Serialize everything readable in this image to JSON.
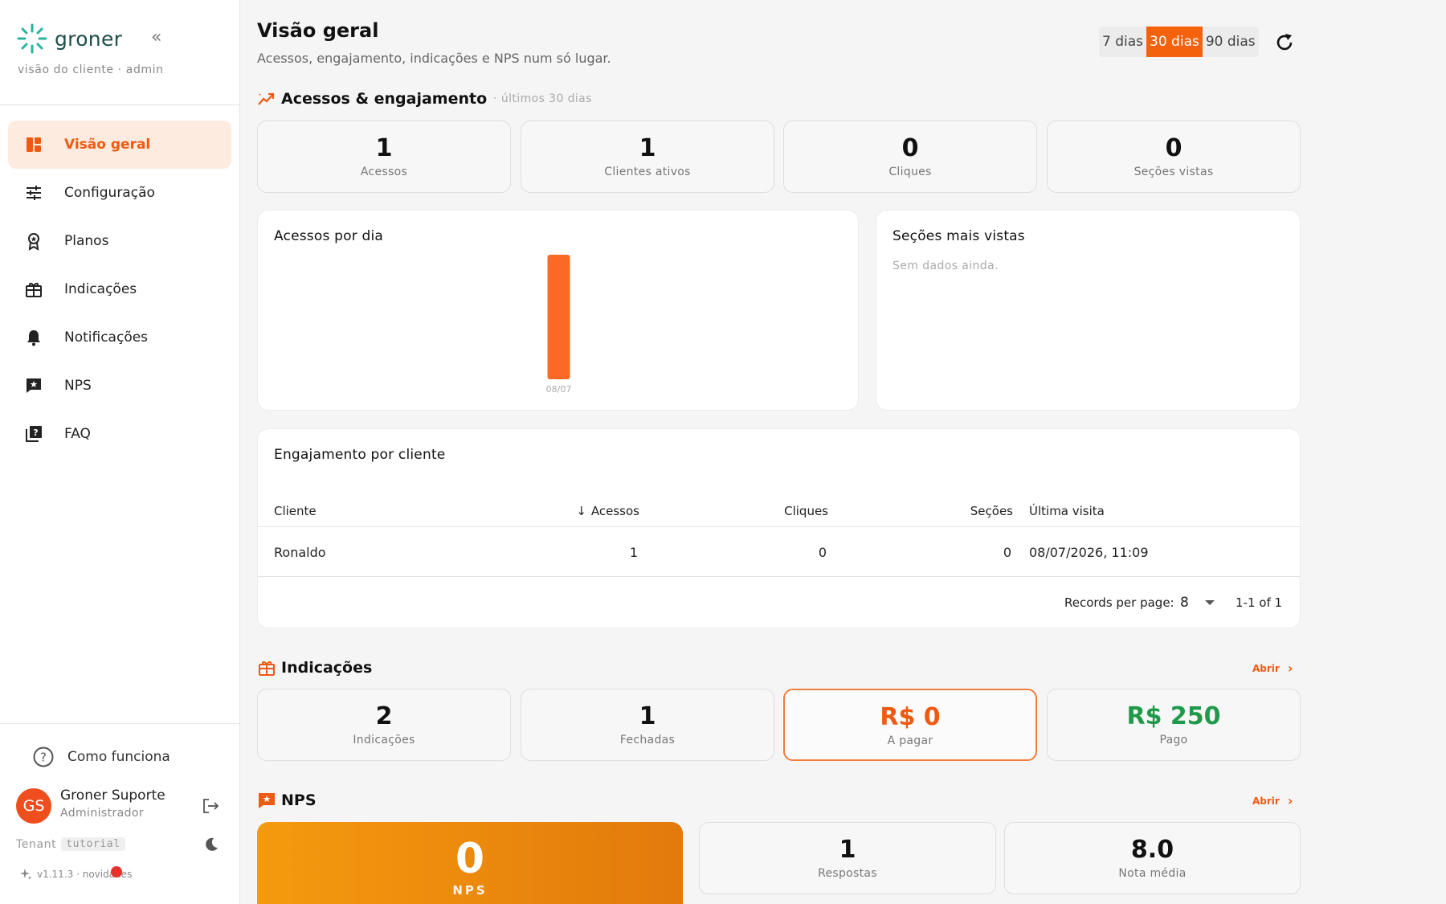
{
  "brand": {
    "name": "groner",
    "subtitle": "visão do cliente · admin",
    "collapse": "«"
  },
  "nav": [
    {
      "label": "Visão geral",
      "icon": "dashboard-icon",
      "active": true
    },
    {
      "label": "Configuração",
      "icon": "sliders-icon"
    },
    {
      "label": "Planos",
      "icon": "award-icon"
    },
    {
      "label": "Indicações",
      "icon": "gift-icon"
    },
    {
      "label": "Notificações",
      "icon": "bell-icon"
    },
    {
      "label": "NPS",
      "icon": "nps-icon"
    },
    {
      "label": "FAQ",
      "icon": "faq-icon"
    }
  ],
  "help": {
    "label": "Como funciona"
  },
  "user": {
    "initials": "GS",
    "name": "Groner Suporte",
    "role": "Administrador"
  },
  "tenant": {
    "label": "Tenant",
    "code": "tutorial"
  },
  "version": {
    "text": "v1.11.3 · novidades"
  },
  "header": {
    "title": "Visão geral",
    "subtitle": "Acessos, engajamento, indicações e NPS num só lugar.",
    "ranges": [
      "7 dias",
      "30 dias",
      "90 dias"
    ],
    "active_range": "30 dias"
  },
  "engagement": {
    "title": "Acessos & engajamento",
    "note": "· últimos 30 dias",
    "stats": [
      {
        "value": "1",
        "label": "Acessos"
      },
      {
        "value": "1",
        "label": "Clientes ativos"
      },
      {
        "value": "0",
        "label": "Cliques"
      },
      {
        "value": "0",
        "label": "Seções vistas"
      }
    ]
  },
  "chart_data": {
    "type": "bar",
    "title": "Acessos por dia",
    "categories": [
      "08/07"
    ],
    "values": [
      1
    ],
    "ylim": [
      0,
      1
    ],
    "grid": false,
    "color": "#fb6a24"
  },
  "top_sections": {
    "title": "Seções mais vistas",
    "empty": "Sem dados ainda."
  },
  "table": {
    "title": "Engajamento por cliente",
    "columns": [
      "Cliente",
      "Acessos",
      "Cliques",
      "Seções",
      "Última visita"
    ],
    "sort_indicator": "↓",
    "rows": [
      {
        "cliente": "Ronaldo",
        "acessos": "1",
        "cliques": "0",
        "secoes": "0",
        "ultima": "08/07/2026, 11:09"
      }
    ],
    "per_page_label": "Records per page:",
    "per_page": "8",
    "range": "1-1 of 1"
  },
  "referrals": {
    "title": "Indicações",
    "open": "Abrir",
    "stats": [
      {
        "value": "2",
        "label": "Indicações"
      },
      {
        "value": "1",
        "label": "Fechadas"
      },
      {
        "value": "R$ 0",
        "label": "A pagar"
      },
      {
        "value": "R$ 250",
        "label": "Pago"
      }
    ]
  },
  "nps": {
    "title": "NPS",
    "open": "Abrir",
    "score": "0",
    "score_label": "NPS",
    "stats": [
      {
        "value": "1",
        "label": "Respostas"
      },
      {
        "value": "8.0",
        "label": "Nota média"
      }
    ]
  },
  "colors": {
    "accent": "#f5620d",
    "positive": "#1e9a4a",
    "active_bg": "#fdebe0"
  }
}
